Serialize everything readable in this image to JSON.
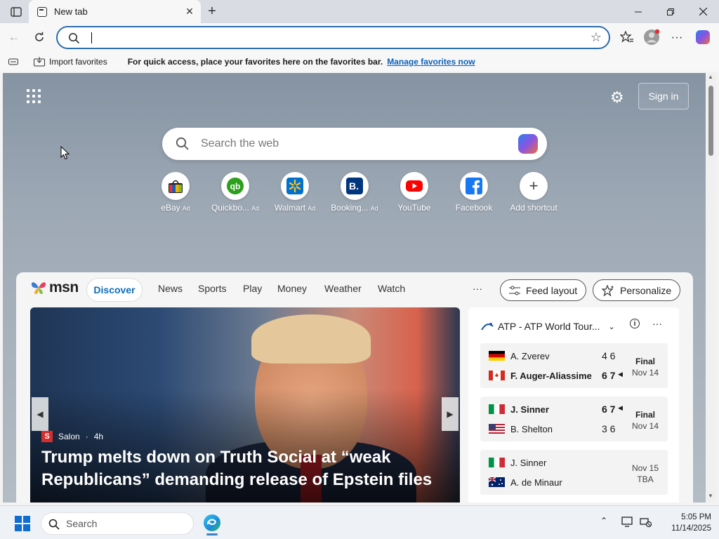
{
  "browser": {
    "tab_title": "New tab",
    "address_value": "",
    "favorites_bar": {
      "import_label": "Import favorites",
      "message": "For quick access, place your favorites here on the favorites bar.",
      "manage_link": "Manage favorites now"
    }
  },
  "newtab": {
    "sign_in": "Sign in",
    "search_placeholder": "Search the web",
    "shortcuts": [
      {
        "label": "eBay",
        "ad": "Ad"
      },
      {
        "label": "Quickbo...",
        "ad": "Ad"
      },
      {
        "label": "Walmart",
        "ad": "Ad"
      },
      {
        "label": "Booking...",
        "ad": "Ad"
      },
      {
        "label": "YouTube",
        "ad": ""
      },
      {
        "label": "Facebook",
        "ad": ""
      },
      {
        "label": "Add shortcut",
        "ad": ""
      }
    ]
  },
  "feed": {
    "brand": "msn",
    "tabs": [
      "Discover",
      "News",
      "Sports",
      "Play",
      "Money",
      "Weather",
      "Watch"
    ],
    "more": "···",
    "feed_layout": "Feed layout",
    "personalize": "Personalize",
    "hero": {
      "source": "Salon",
      "age": "4h",
      "headline": "Trump melts down on Truth Social at “weak Republicans” demanding release of Epstein files"
    },
    "atp": {
      "title": "ATP - ATP World Tour...",
      "matches": [
        {
          "p1": "A. Zverev",
          "p1_score": "4 6",
          "p2": "F. Auger-Aliassime",
          "p2_score": "6 7",
          "status1": "Final",
          "status2": "Nov 14",
          "winner": 2
        },
        {
          "p1": "J. Sinner",
          "p1_score": "6 7",
          "p2": "B. Shelton",
          "p2_score": "3 6",
          "status1": "Final",
          "status2": "Nov 14",
          "winner": 1
        },
        {
          "p1": "J. Sinner",
          "p1_score": "",
          "p2": "A. de Minaur",
          "p2_score": "",
          "status1": "Nov 15",
          "status2": "TBA",
          "winner": 0
        }
      ]
    }
  },
  "taskbar": {
    "search_placeholder": "Search",
    "time": "5:05 PM",
    "date": "11/14/2025"
  },
  "colors": {
    "accent": "#0f6cbd",
    "address_border": "#2b6cb0",
    "link": "#0b61b8"
  }
}
